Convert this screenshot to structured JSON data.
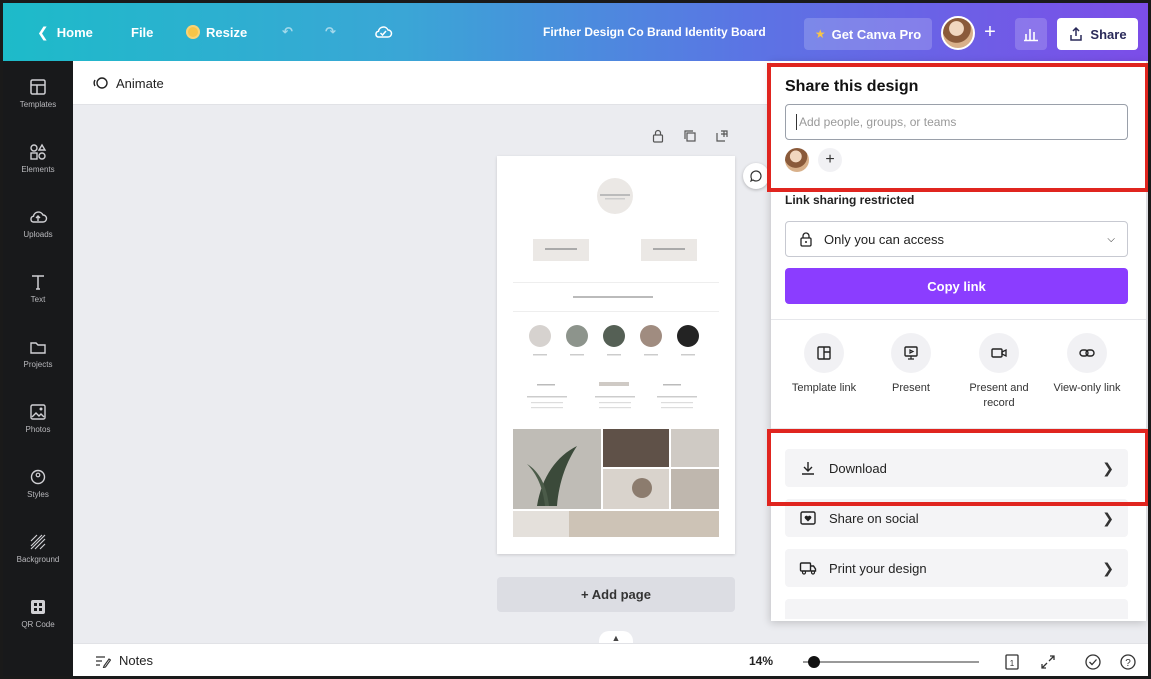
{
  "topbar": {
    "home_label": "Home",
    "file_label": "File",
    "resize_label": "Resize",
    "design_title": "Firther Design Co Brand Identity Board",
    "pro_label": "Get Canva Pro",
    "share_label": "Share"
  },
  "sidebar": {
    "items": [
      {
        "label": "Templates",
        "icon": "templates-icon"
      },
      {
        "label": "Elements",
        "icon": "elements-icon"
      },
      {
        "label": "Uploads",
        "icon": "uploads-icon"
      },
      {
        "label": "Text",
        "icon": "text-icon"
      },
      {
        "label": "Projects",
        "icon": "folder-icon"
      },
      {
        "label": "Photos",
        "icon": "photos-icon"
      },
      {
        "label": "Styles",
        "icon": "palette-icon"
      },
      {
        "label": "Background",
        "icon": "background-icon"
      },
      {
        "label": "QR Code",
        "icon": "qr-code-icon"
      }
    ]
  },
  "toolbar": {
    "animate_label": "Animate"
  },
  "canvas": {
    "add_page_label": "+ Add page",
    "swatch_colors": [
      "#d6d2cf",
      "#8d948c",
      "#556055",
      "#a08c80",
      "#232323"
    ]
  },
  "bottombar": {
    "notes_label": "Notes",
    "zoom_label": "14%",
    "zoom_fraction": 0.06
  },
  "share_panel": {
    "title": "Share this design",
    "input_placeholder": "Add people, groups, or teams",
    "link_sharing_label": "Link sharing restricted",
    "access_value": "Only you can access",
    "copy_link_label": "Copy link",
    "options": [
      {
        "label": "Template link",
        "icon": "template-icon"
      },
      {
        "label": "Present",
        "icon": "present-icon"
      },
      {
        "label": "Present and record",
        "icon": "record-icon"
      },
      {
        "label": "View-only link",
        "icon": "link-icon"
      }
    ],
    "actions": [
      {
        "label": "Download",
        "icon": "download-icon"
      },
      {
        "label": "Share on social",
        "icon": "heart-icon"
      },
      {
        "label": "Print your design",
        "icon": "truck-icon"
      }
    ]
  },
  "colors": {
    "accent": "#8b3dff",
    "highlight": "#e0251f",
    "sidebar_bg": "#18191b"
  }
}
